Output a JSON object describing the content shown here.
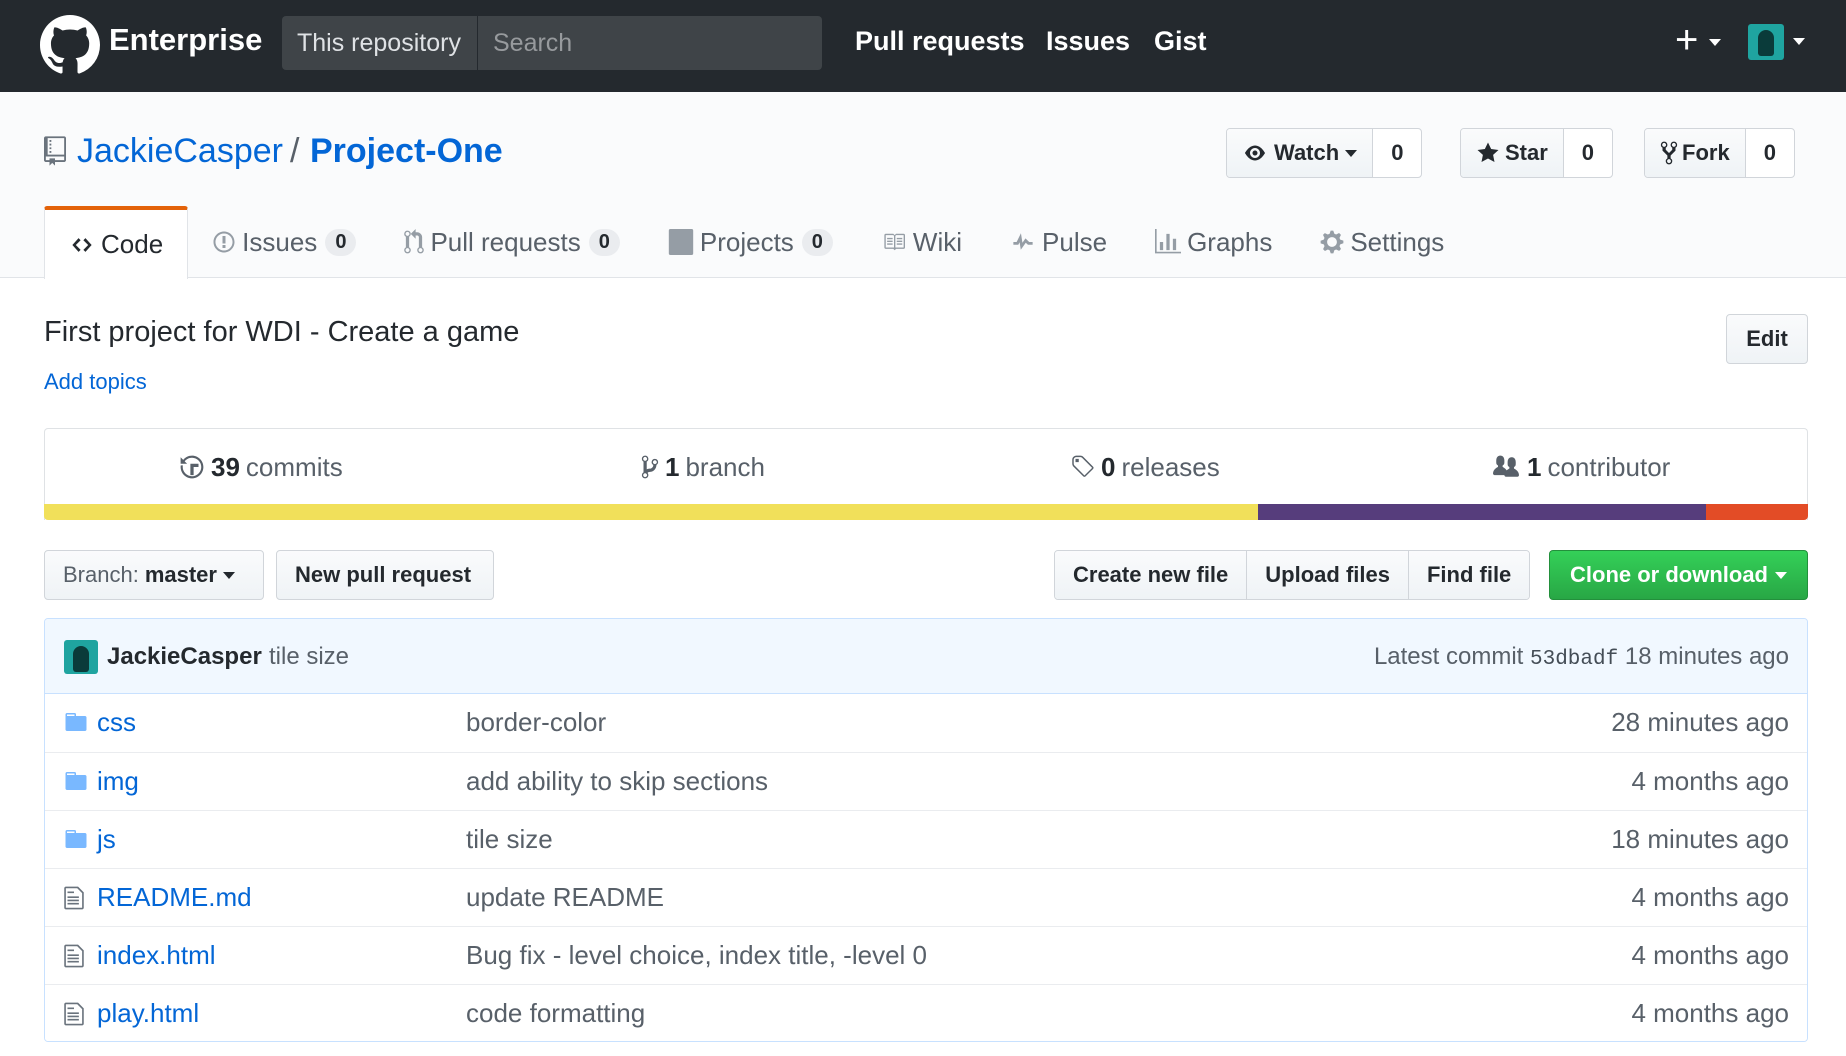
{
  "header": {
    "brand": "Enterprise",
    "scope": "This repository",
    "search_placeholder": "Search",
    "nav": [
      "Pull requests",
      "Issues",
      "Gist"
    ],
    "plus": "+"
  },
  "repo": {
    "owner": "JackieCasper",
    "separator": "/",
    "name": "Project-One",
    "watch_label": "Watch",
    "watch_count": "0",
    "star_label": "Star",
    "star_count": "0",
    "fork_label": "Fork",
    "fork_count": "0"
  },
  "tabs": [
    {
      "label": "Code",
      "count": null,
      "icon": "code-icon"
    },
    {
      "label": "Issues",
      "count": "0",
      "icon": "issue-icon"
    },
    {
      "label": "Pull requests",
      "count": "0",
      "icon": "pull-request-icon"
    },
    {
      "label": "Projects",
      "count": "0",
      "icon": "project-icon"
    },
    {
      "label": "Wiki",
      "count": null,
      "icon": "book-icon"
    },
    {
      "label": "Pulse",
      "count": null,
      "icon": "pulse-icon"
    },
    {
      "label": "Graphs",
      "count": null,
      "icon": "graph-icon"
    },
    {
      "label": "Settings",
      "count": null,
      "icon": "gear-icon"
    }
  ],
  "about": {
    "description": "First project for WDI - Create a game",
    "add_topics": "Add topics",
    "edit_label": "Edit"
  },
  "summary": {
    "commits_num": "39",
    "commits_label": "commits",
    "branch_num": "1",
    "branch_label": "branch",
    "releases_num": "0",
    "releases_label": "releases",
    "contributor_num": "1",
    "contributor_label": "contributor"
  },
  "language_colors": [
    "#f1e05a",
    "#563d7c",
    "#e34c26"
  ],
  "language_shares": [
    0.688,
    0.254,
    0.058
  ],
  "file_nav": {
    "branch_prefix": "Branch:",
    "branch_value": "master",
    "new_pr": "New pull request",
    "create_file": "Create new file",
    "upload_files": "Upload files",
    "find_file": "Find file",
    "clone": "Clone or download"
  },
  "latest_commit": {
    "author": "JackieCasper",
    "message": "tile size",
    "prefix": "Latest commit",
    "sha": "53dbadf",
    "age": "18 minutes ago"
  },
  "files": [
    {
      "name": "css",
      "type": "folder",
      "message": "border-color",
      "age": "28 minutes ago"
    },
    {
      "name": "img",
      "type": "folder",
      "message": "add ability to skip sections",
      "age": "4 months ago"
    },
    {
      "name": "js",
      "type": "folder",
      "message": "tile size",
      "age": "18 minutes ago"
    },
    {
      "name": "README.md",
      "type": "file",
      "message": "update README",
      "age": "4 months ago"
    },
    {
      "name": "index.html",
      "type": "file",
      "message": "Bug fix - level choice, index title, -level 0",
      "age": "4 months ago"
    },
    {
      "name": "play.html",
      "type": "file",
      "message": "code formatting",
      "age": "4 months ago"
    }
  ],
  "colors": {
    "header_bg": "#24292e",
    "link": "#0366d6",
    "tab_accent": "#e36209",
    "clone_green": "#28a745"
  }
}
